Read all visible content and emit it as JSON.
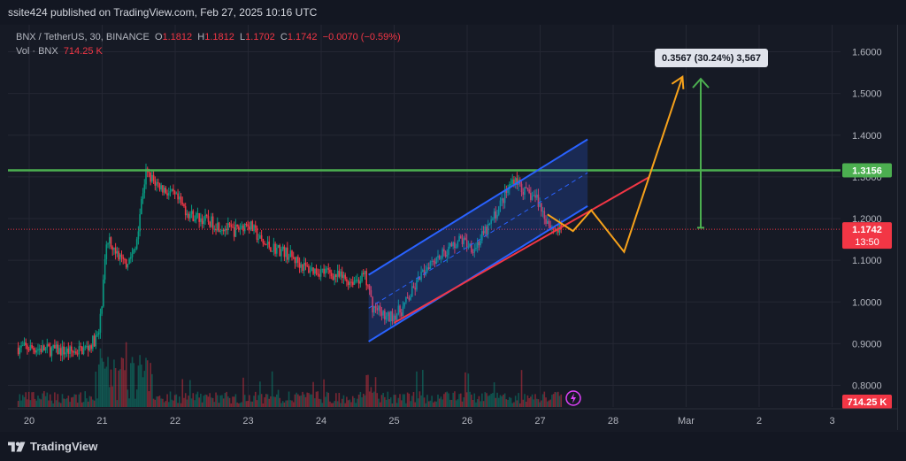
{
  "header": {
    "published_text": "ssite424 published on TradingView.com, Feb 27, 2025 10:16 UTC"
  },
  "legend": {
    "symbol": "BNX / TetherUS, 30, BINANCE",
    "open_label": "O",
    "open": "1.1812",
    "high_label": "H",
    "high": "1.1812",
    "low_label": "L",
    "low": "1.1702",
    "close_label": "C",
    "close": "1.1742",
    "change": "−0.0070 (−0.59%)",
    "volume_label": "Vol · BNX",
    "volume": "714.25 K"
  },
  "footer": {
    "brand": "TradingView"
  },
  "colors": {
    "background": "#161a25",
    "up": "#089981",
    "down": "#f23645",
    "channel": "#2962ff",
    "resistance": "#4caf50",
    "projection": "#f7a21b",
    "measure": "#4caf50"
  },
  "chart_data": {
    "type": "candlestick",
    "symbol": "BNX / TetherUS",
    "interval": "30",
    "exchange": "BINANCE",
    "x_ticks": [
      "20",
      "21",
      "22",
      "23",
      "24",
      "25",
      "26",
      "27",
      "28",
      "Mar",
      "2",
      "3"
    ],
    "y_ticks": [
      "1.6000",
      "1.5000",
      "1.4000",
      "1.3000",
      "1.2000",
      "1.1000",
      "1.0000",
      "0.9000",
      "0.8000"
    ],
    "ylim": [
      0.77,
      1.67
    ],
    "price_path": [
      [
        20.0,
        0.89
      ],
      [
        20.3,
        0.885
      ],
      [
        20.6,
        0.88
      ],
      [
        20.8,
        0.89
      ],
      [
        20.95,
        0.92
      ],
      [
        21.0,
        1.0
      ],
      [
        21.05,
        1.12
      ],
      [
        21.1,
        1.16
      ],
      [
        21.15,
        1.13
      ],
      [
        21.3,
        1.09
      ],
      [
        21.45,
        1.12
      ],
      [
        21.55,
        1.26
      ],
      [
        21.6,
        1.31
      ],
      [
        21.7,
        1.29
      ],
      [
        21.85,
        1.27
      ],
      [
        22.0,
        1.25
      ],
      [
        22.2,
        1.21
      ],
      [
        22.5,
        1.19
      ],
      [
        22.8,
        1.17
      ],
      [
        23.0,
        1.19
      ],
      [
        23.2,
        1.14
      ],
      [
        23.5,
        1.12
      ],
      [
        23.8,
        1.08
      ],
      [
        24.1,
        1.07
      ],
      [
        24.4,
        1.05
      ],
      [
        24.6,
        1.06
      ],
      [
        24.7,
        0.99
      ],
      [
        24.9,
        0.96
      ],
      [
        25.1,
        0.98
      ],
      [
        25.3,
        1.04
      ],
      [
        25.5,
        1.1
      ],
      [
        25.7,
        1.12
      ],
      [
        25.9,
        1.15
      ],
      [
        26.1,
        1.13
      ],
      [
        26.3,
        1.18
      ],
      [
        26.5,
        1.25
      ],
      [
        26.65,
        1.3
      ],
      [
        26.8,
        1.26
      ],
      [
        26.95,
        1.25
      ],
      [
        27.05,
        1.21
      ],
      [
        27.15,
        1.18
      ],
      [
        27.3,
        1.17
      ]
    ],
    "last_price": "1.1742",
    "countdown": "13:50",
    "resistance_level": "1.3156",
    "volume_last": "714.25 K",
    "measure_label": "0.3567 (30.24%) 3,567",
    "channel": {
      "lower": [
        [
          24.65,
          0.905
        ],
        [
          27.65,
          1.23
        ]
      ],
      "upper": [
        [
          24.65,
          1.065
        ],
        [
          27.65,
          1.39
        ]
      ],
      "midline": true
    },
    "trendline_red": [
      [
        25.0,
        0.95
      ],
      [
        28.5,
        1.3
      ]
    ],
    "projection_path": [
      [
        27.1,
        1.21
      ],
      [
        27.45,
        1.17
      ],
      [
        27.7,
        1.22
      ],
      [
        28.15,
        1.12
      ],
      [
        28.95,
        1.54
      ]
    ],
    "measure": {
      "x": 29.2,
      "from": 1.178,
      "to": 1.535
    },
    "grid": true,
    "legend_position": "top-left"
  }
}
